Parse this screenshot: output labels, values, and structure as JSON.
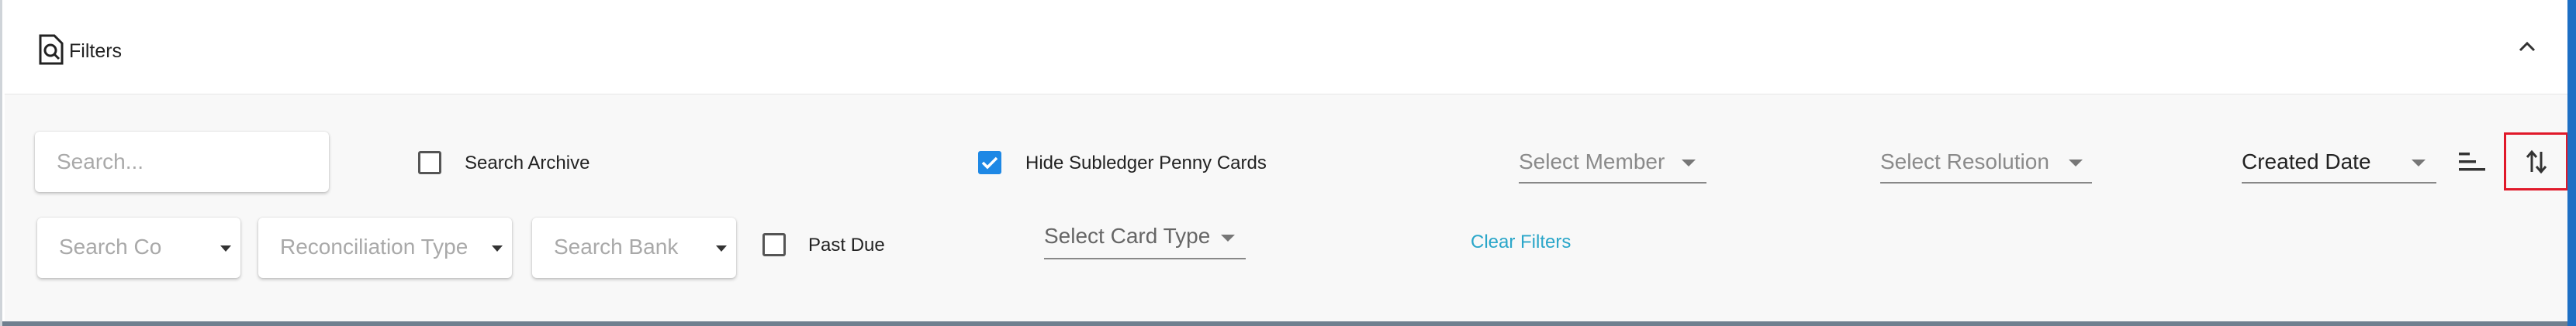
{
  "header": {
    "title": "Filters",
    "collapse_icon": "chevron-up-icon"
  },
  "search": {
    "placeholder": "Search..."
  },
  "search_archive": {
    "label": "Search Archive",
    "checked": false
  },
  "hide_penny": {
    "label": "Hide Subledger Penny Cards",
    "checked": true
  },
  "member_select": {
    "placeholder": "Select Member"
  },
  "resolution_select": {
    "placeholder": "Select Resolution"
  },
  "sort": {
    "selected": "Created Date",
    "order_icon": "sort-lines-icon",
    "direction_icon": "sort-direction-arrows-icon"
  },
  "company_select": {
    "placeholder": "Search Co"
  },
  "recon_type_select": {
    "placeholder": "Reconciliation Type"
  },
  "bank_select": {
    "placeholder": "Search Bank"
  },
  "past_due": {
    "label": "Past Due",
    "checked": false
  },
  "card_type_select": {
    "placeholder": "Select Card Type"
  },
  "clear_filters": {
    "label": "Clear Filters"
  },
  "colors": {
    "accent": "#1e88e5",
    "link": "#2aa6c9",
    "highlight_border": "#e0192a",
    "right_bar": "#1d6fc4"
  }
}
